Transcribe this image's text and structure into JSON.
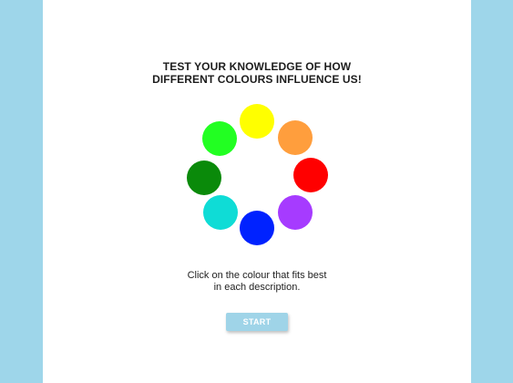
{
  "page": {
    "background_color": "#9ed6ea",
    "panel_color": "#ffffff"
  },
  "header": {
    "title_line1": "TEST YOUR KNOWLEDGE OF HOW",
    "title_line2": "DIFFERENT COLOURS INFLUENCE US!"
  },
  "color_wheel": {
    "colors": [
      {
        "name": "yellow",
        "hex": "#ffff00"
      },
      {
        "name": "orange",
        "hex": "#ff9e3d"
      },
      {
        "name": "red",
        "hex": "#ff0000"
      },
      {
        "name": "purple",
        "hex": "#a63bff"
      },
      {
        "name": "blue",
        "hex": "#0022ff"
      },
      {
        "name": "turquoise",
        "hex": "#0fdcd6"
      },
      {
        "name": "dark-green",
        "hex": "#0a8a0a"
      },
      {
        "name": "light-green",
        "hex": "#22ff22"
      }
    ]
  },
  "instructions": {
    "line1": "Click on the colour that fits best",
    "line2": "in each description."
  },
  "start_button": {
    "label": "START",
    "color": "#9fd4e8"
  }
}
